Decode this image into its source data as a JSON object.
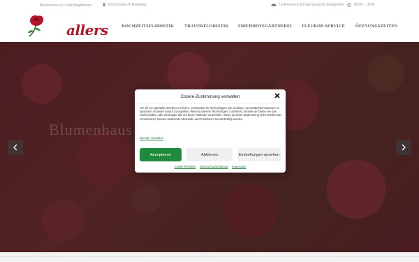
{
  "topbar": {
    "tagline": "Blumenhaus & Friedhofsgärtnerei",
    "address": "Kirchstraße 26 Bamberg",
    "delivery": "Lieferservice für das gesamte Stadtgebiet",
    "hours": "08:00 - 18:00"
  },
  "logo": {
    "text": "allers"
  },
  "nav": {
    "items": [
      {
        "label": "HOCHZEITSFLORISTIK"
      },
      {
        "label": "TRAUERFLORISTIK"
      },
      {
        "label": "FRIEDHOFSGÄRTNEREI"
      },
      {
        "label": "FLEUROP-SERVICE"
      },
      {
        "label": "ÖFFNUNGSZEITEN"
      }
    ]
  },
  "hero": {
    "title": "Blumenhaus Allers"
  },
  "consent": {
    "title": "Cookie-Zustimmung verwalten",
    "body": "Um dir ein optimales Erlebnis zu bieten, verwenden wir Technologien wie Cookies, um Geräteinformationen zu speichern und/oder darauf zuzugreifen. Wenn du diesen Technologien zustimmst, können wir Daten wie das Surfverhalten oder eindeutige IDs auf dieser Website verarbeiten. Wenn du deine Zustimmung nicht erteilst oder zurückziehst, können bestimmte Merkmale und Funktionen beeinträchtigt werden.",
    "manage_link": "Dienste verwalten",
    "accept_label": "Akzeptieren",
    "deny_label": "Ablehnen",
    "settings_label": "Einstellungen ansehen",
    "footer_links": [
      "Cookie-Richtlinie",
      "Datenschutzerklärung",
      "Impressum"
    ]
  },
  "colors": {
    "accent": "#1f8a3c",
    "brand": "#b3152a"
  }
}
